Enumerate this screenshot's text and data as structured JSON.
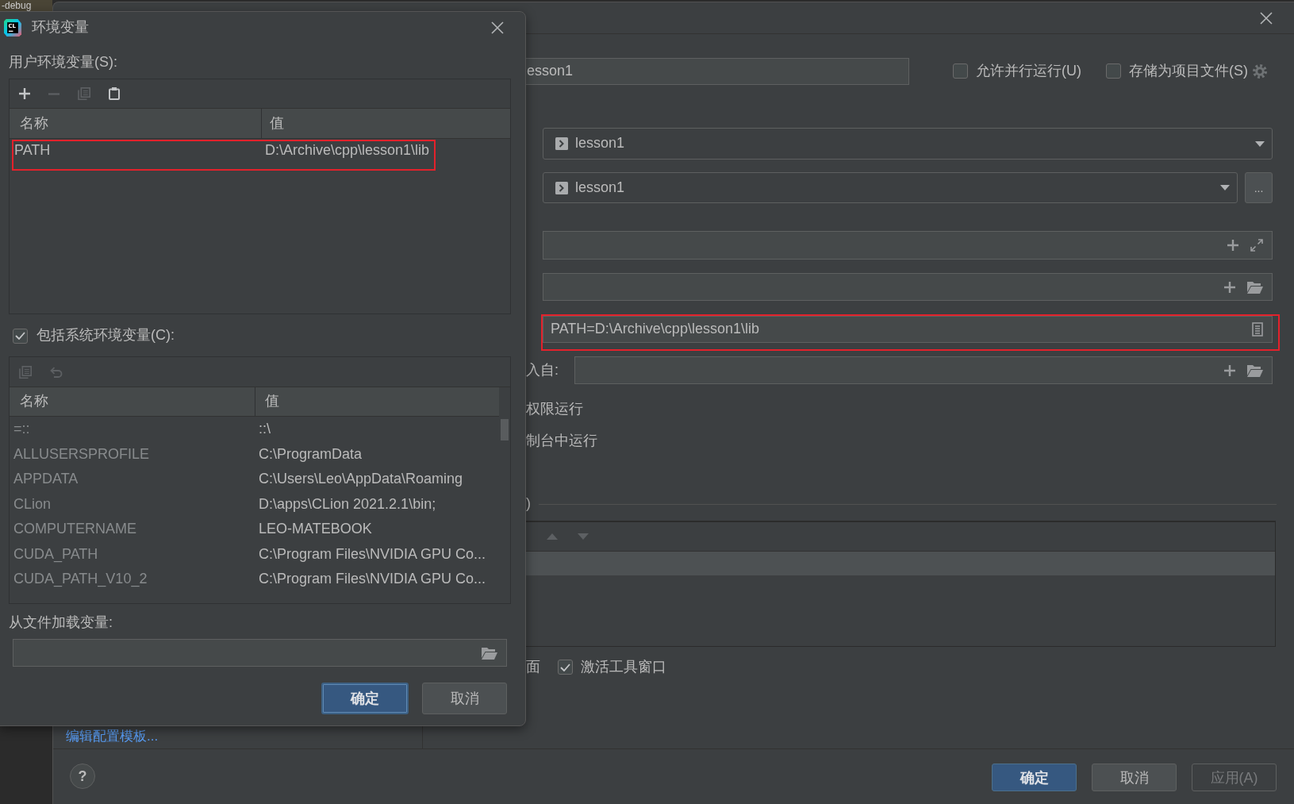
{
  "ide_tab": {
    "label": "-debug"
  },
  "run_dialog": {
    "name_field": {
      "value": "esson1"
    },
    "header_options": [
      {
        "label": "允许并行运行(U)",
        "checked": false
      },
      {
        "label": "存储为项目文件(S)",
        "checked": false
      }
    ],
    "combos": [
      {
        "value": "lesson1"
      },
      {
        "value": "lesson1",
        "more_button": "..."
      }
    ],
    "fields": [
      {
        "kind": "expandable",
        "highlighted": false
      },
      {
        "kind": "browse",
        "highlighted": false
      },
      {
        "kind": "env",
        "value": "PATH=D:\\Archive\\cpp\\lesson1\\lib",
        "highlighted": true
      },
      {
        "kind": "browse",
        "label": "入自:",
        "highlighted": false
      }
    ],
    "labels": [
      "权限运行",
      "制台中运行"
    ],
    "group": {
      "title": ")",
      "toolbar": [
        {
          "kind": "up",
          "disabled": true
        },
        {
          "kind": "down",
          "disabled": true
        }
      ],
      "rows": [
        {
          "selected": true
        }
      ]
    },
    "bottom_label": "面",
    "bottom_options": [
      {
        "label": "激活工具窗口",
        "checked": true
      }
    ],
    "sidebar_link": "编辑配置模板...",
    "help_button": "?",
    "buttons": [
      {
        "label": "确定",
        "kind": "primary",
        "disabled": false
      },
      {
        "label": "取消",
        "kind": "secondary",
        "disabled": false
      },
      {
        "label": "应用(A)",
        "kind": "secondary",
        "disabled": true
      }
    ]
  },
  "env_dialog": {
    "logo_text": "CL",
    "title": "环境变量",
    "user_vars": {
      "label": "用户环境变量(S):",
      "toolbar": [
        {
          "kind": "add",
          "disabled": false
        },
        {
          "kind": "remove",
          "disabled": true
        },
        {
          "kind": "copy",
          "disabled": true
        },
        {
          "kind": "paste",
          "disabled": false
        }
      ],
      "columns": [
        "名称",
        "值"
      ],
      "rows": [
        {
          "name": "PATH",
          "value": "D:\\Archive\\cpp\\lesson1\\lib",
          "highlighted": true
        }
      ]
    },
    "include_system": {
      "label": "包括系统环境变量(C):",
      "checked": true
    },
    "system_vars": {
      "toolbar": [
        {
          "kind": "copy",
          "disabled": true
        },
        {
          "kind": "undo",
          "disabled": true
        }
      ],
      "columns": [
        "名称",
        "值"
      ],
      "rows": [
        {
          "name": "=::",
          "value": "::\\"
        },
        {
          "name": "ALLUSERSPROFILE",
          "value": "C:\\ProgramData"
        },
        {
          "name": "APPDATA",
          "value": "C:\\Users\\Leo\\AppData\\Roaming"
        },
        {
          "name": "CLion",
          "value": "D:\\apps\\CLion 2021.2.1\\bin;"
        },
        {
          "name": "COMPUTERNAME",
          "value": "LEO-MATEBOOK"
        },
        {
          "name": "CUDA_PATH",
          "value": "C:\\Program Files\\NVIDIA GPU Co..."
        },
        {
          "name": "CUDA_PATH_V10_2",
          "value": "C:\\Program Files\\NVIDIA GPU Co..."
        }
      ]
    },
    "file_label": "从文件加载变量:",
    "buttons": [
      {
        "label": "确定",
        "kind": "primary",
        "focused": true
      },
      {
        "label": "取消",
        "kind": "secondary",
        "focused": false
      }
    ]
  }
}
